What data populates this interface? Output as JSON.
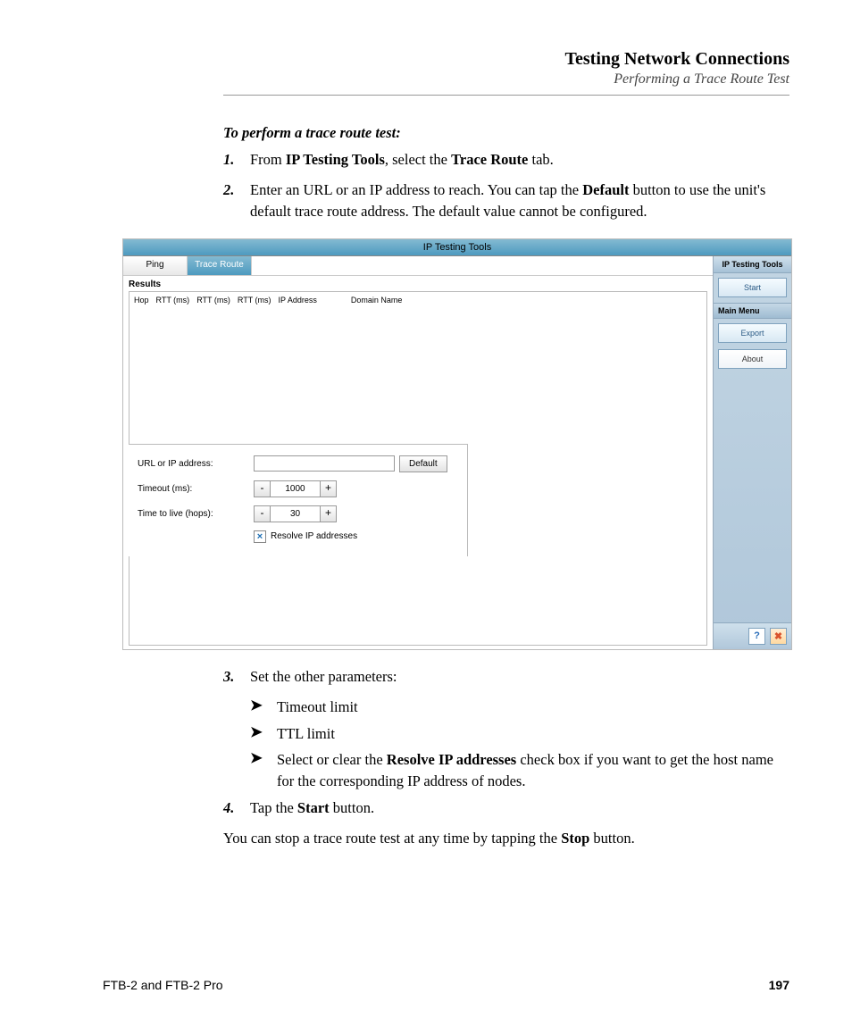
{
  "header": {
    "title": "Testing Network Connections",
    "subtitle": "Performing a Trace Route Test"
  },
  "intro": "To perform a trace route test:",
  "steps": {
    "s1": {
      "num": "1.",
      "pre": "From ",
      "b1": "IP Testing Tools",
      "mid": ", select the ",
      "b2": "Trace Route",
      "post": " tab."
    },
    "s2": {
      "num": "2.",
      "pre": "Enter an URL or an IP address to reach. You can tap the ",
      "b1": "Default",
      "post": " button to use the unit's default trace route address. The default value cannot be configured."
    },
    "s3": {
      "num": "3.",
      "text": "Set the other parameters:"
    },
    "bullets": {
      "b1": "Timeout limit",
      "b2": "TTL limit",
      "b3_pre": "Select or clear the ",
      "b3_bold": "Resolve IP addresses",
      "b3_post": " check box if you want to get the host name for the corresponding IP address of nodes."
    },
    "s4": {
      "num": "4.",
      "pre": "Tap the ",
      "b1": "Start",
      "post": " button."
    },
    "after": {
      "pre": "You can stop a trace route test at any time by tapping the ",
      "b1": "Stop",
      "post": " button."
    }
  },
  "screenshot": {
    "title": "IP Testing Tools",
    "tab_ping": "Ping",
    "tab_trace": "Trace Route",
    "results_label": "Results",
    "cols": {
      "hop": "Hop",
      "rtt1": "RTT (ms)",
      "rtt2": "RTT (ms)",
      "rtt3": "RTT (ms)",
      "ip": "IP Address",
      "domain": "Domain Name"
    },
    "form": {
      "url_label": "URL or IP address:",
      "default_btn": "Default",
      "timeout_label": "Timeout (ms):",
      "timeout_val": "1000",
      "ttl_label": "Time to live (hops):",
      "ttl_val": "30",
      "minus": "-",
      "plus": "+",
      "resolve": "Resolve IP addresses",
      "check": "×"
    },
    "side": {
      "header1": "IP Testing Tools",
      "start": "Start",
      "menu": "Main Menu",
      "export": "Export",
      "about": "About",
      "help": "?",
      "close": "✖"
    }
  },
  "footer": {
    "left": "FTB-2 and FTB-2 Pro",
    "right": "197"
  }
}
